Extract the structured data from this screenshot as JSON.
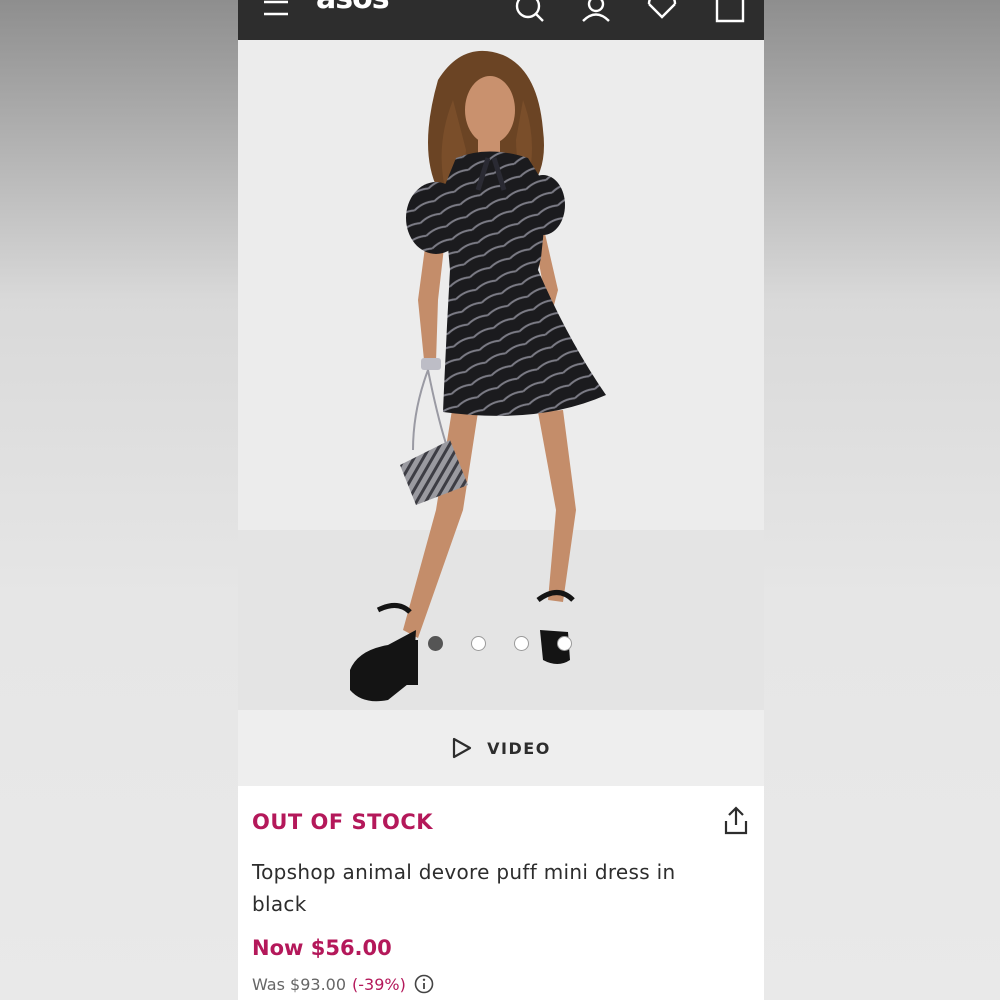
{
  "header": {
    "logo": "asos",
    "icons": [
      "menu-icon",
      "search-icon",
      "account-icon",
      "heart-icon",
      "bag-icon"
    ]
  },
  "gallery": {
    "image_count": 4,
    "active_index": 0
  },
  "video": {
    "label": "VIDEO"
  },
  "product": {
    "stock_status": "OUT OF STOCK",
    "title": "Topshop animal devore puff mini dress in black",
    "now_price": "Now $56.00",
    "was_price": "Was $93.00",
    "discount": "(-39%)"
  },
  "colors": {
    "header_bg": "#2d2d2d",
    "accent": "#b4185a"
  }
}
